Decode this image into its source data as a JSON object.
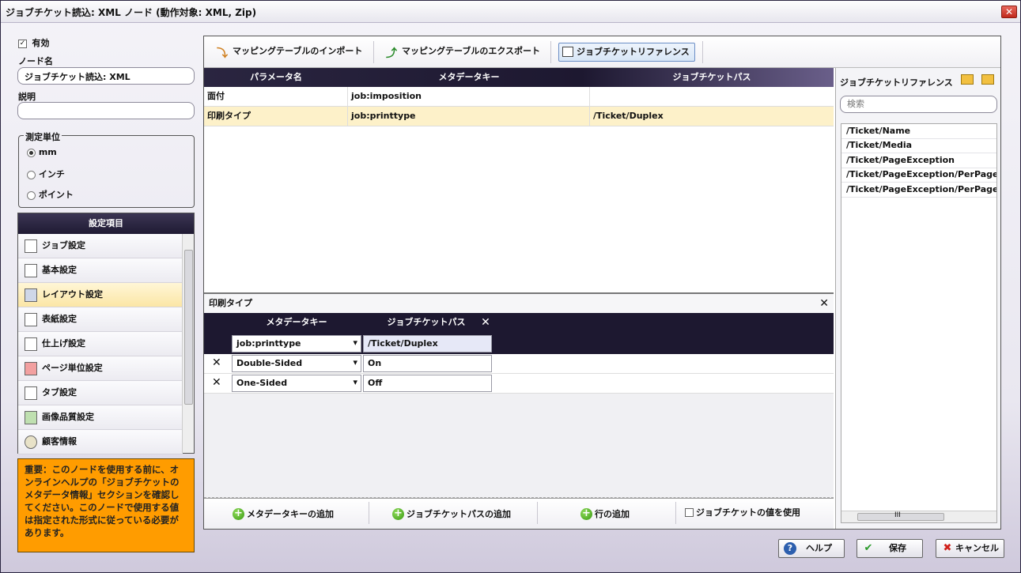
{
  "window": {
    "title": "ジョブチケット読込: XML ノード (動作対象: XML, Zip)",
    "close_label": "✕"
  },
  "left": {
    "enabled_label": "有効",
    "node_name_label": "ノード名",
    "node_name_value": "ジョブチケット読込: XML",
    "description_label": "説明",
    "description_value": "",
    "unit_group": {
      "caption": "測定単位",
      "options": [
        "mm",
        "インチ",
        "ポイント"
      ],
      "selected": "mm"
    },
    "settings": {
      "header": "設定項目",
      "items": [
        "ジョブ設定",
        "基本設定",
        "レイアウト設定",
        "表紙設定",
        "仕上げ設定",
        "ページ単位設定",
        "タブ設定",
        "画像品質設定",
        "顧客情報"
      ],
      "selected": "レイアウト設定"
    },
    "note": "重要：このノードを使用する前に、オンラインヘルプの「ジョブチケットのメタデータ情報」セクションを確認してください。このノードで使用する値は指定された形式に従っている必要があります。"
  },
  "toolbar": {
    "import_label": "マッピングテーブルのインポート",
    "export_label": "マッピングテーブルのエクスポート",
    "reference_label": "ジョブチケットリファレンス"
  },
  "mapping": {
    "columns": [
      "パラメータ名",
      "メタデータキー",
      "ジョブチケットパス"
    ],
    "rows": [
      {
        "param": "面付",
        "key": "job:imposition",
        "path": ""
      },
      {
        "param": "印刷タイプ",
        "key": "job:printtype",
        "path": "/Ticket/Duplex"
      }
    ]
  },
  "detail": {
    "title": "印刷タイプ",
    "columns": [
      "メタデータキー",
      "ジョブチケットパス"
    ],
    "key_select": "job:printtype",
    "path_value": "/Ticket/Duplex",
    "rows": [
      {
        "key": "Double-Sided",
        "value": "On"
      },
      {
        "key": "One-Sided",
        "value": "Off"
      }
    ],
    "buttons": {
      "add_key": "メタデータキーの追加",
      "add_path": "ジョブチケットパスの追加",
      "add_row": "行の追加",
      "use_ticket_value": "ジョブチケットの値を使用"
    }
  },
  "reference": {
    "title": "ジョブチケットリファレンス",
    "search_placeholder": "検索",
    "items": [
      "/Ticket/Name",
      "/Ticket/Media",
      "/Ticket/PageException",
      "/Ticket/PageException/PerPageS",
      "/Ticket/PageException/PerPageS"
    ],
    "scroll_grip": "III"
  },
  "footer": {
    "help": "ヘルプ",
    "save": "保存",
    "cancel": "キャンセル"
  },
  "colors": {
    "accent_header": "#1f1a33",
    "selection": "#fdf1c9",
    "note_bg": "#ff9c00"
  }
}
